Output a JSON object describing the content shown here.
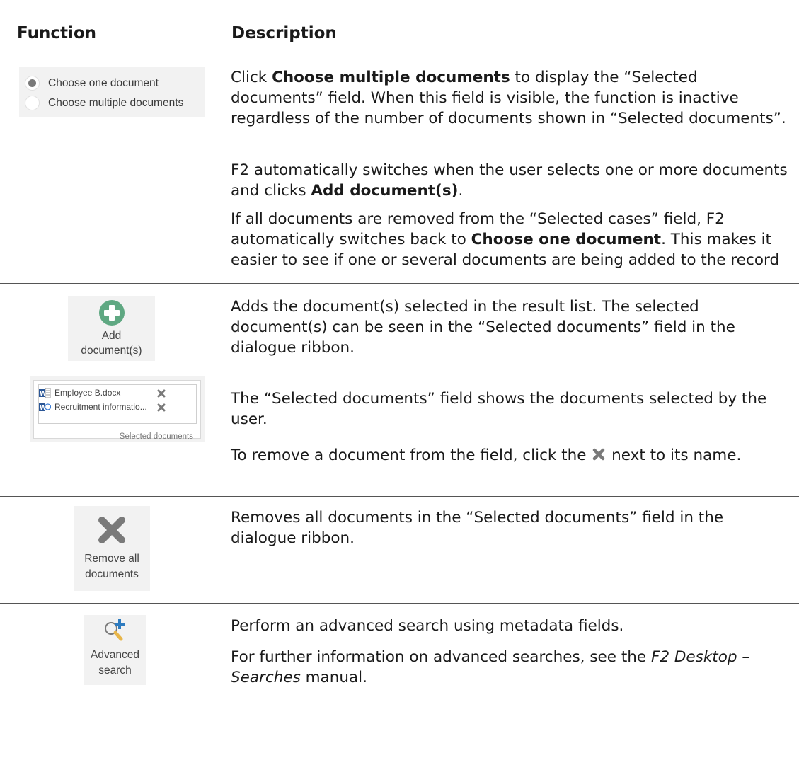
{
  "header": {
    "function": "Function",
    "description": "Description"
  },
  "rows": {
    "choose": {
      "thumb": {
        "option_one": "Choose one document",
        "option_multiple": "Choose multiple documents",
        "selected": "Choose one document"
      },
      "p1": {
        "a": "Click ",
        "b": "Choose multiple documents",
        "c": " to display the “Selected documents” field. When this field is visible, the function is inactive regardless of the number of documents shown in “Selected documents”."
      },
      "p2": {
        "a": "F2 automatically switches when the user selects one or more documents and clicks ",
        "b": "Add document(s)",
        "c": "."
      },
      "p3": {
        "a": "If all documents are removed from the “Selected cases” field, F2 automatically switches back to ",
        "b": "Choose one document",
        "c": ". This makes it easier to see if one or several documents are being added to the record"
      }
    },
    "add": {
      "thumb": {
        "line1": "Add",
        "line2": "document(s)",
        "icon": "plus-circle-icon",
        "icon_color": "#5fa882"
      },
      "p1": "Adds the document(s) selected in the result list. The selected document(s) can be seen in the “Selected documents” field in the dialogue ribbon."
    },
    "selected": {
      "thumb": {
        "doc1": "Employee B.docx",
        "doc2": "Recruitment informatio...",
        "caption": "Selected documents",
        "icon": "word-doc-icon",
        "remove_icon": "close-x-icon"
      },
      "p1": "The “Selected documents” field shows the documents selected by the user.",
      "p2": {
        "a": "To remove a document from the field, click the ",
        "b": " next to its name."
      }
    },
    "remove": {
      "thumb": {
        "line1": "Remove all",
        "line2": "documents",
        "icon": "big-x-icon",
        "icon_color": "#7a7a7a"
      },
      "p1": "Removes all documents in the “Selected documents” field in the dialogue ribbon."
    },
    "search": {
      "thumb": {
        "line1": "Advanced",
        "line2": "search",
        "icon": "magnifier-plus-icon",
        "accent": "#2e7bbf",
        "handle_color": "#e8b64a"
      },
      "p1": "Perform an advanced search using metadata fields.",
      "p2": {
        "a": "For further information on advanced searches, see the ",
        "b": "F2 Desktop – Searches",
        "c": " manual."
      }
    }
  }
}
